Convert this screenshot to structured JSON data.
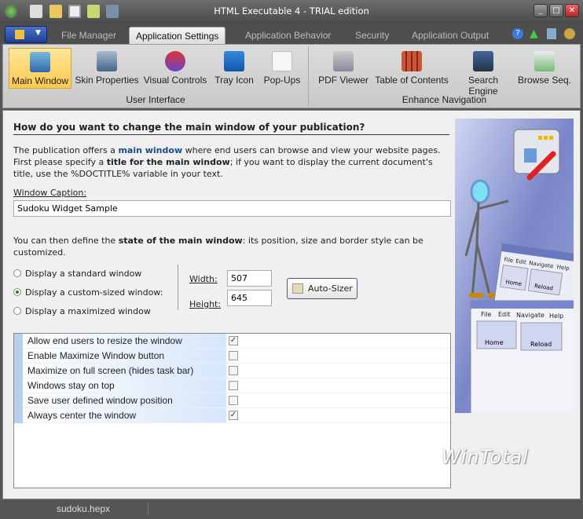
{
  "window": {
    "title": "HTML Executable 4 - TRIAL edition"
  },
  "tabs": [
    {
      "label": "File Manager"
    },
    {
      "label": "Application Settings"
    },
    {
      "label": "Application Behavior"
    },
    {
      "label": "Security"
    },
    {
      "label": "Application Output"
    }
  ],
  "ribbon": {
    "groups": [
      {
        "label": "User Interface",
        "items": [
          {
            "label": "Main Window"
          },
          {
            "label": "Skin Properties"
          },
          {
            "label": "Visual Controls"
          },
          {
            "label": "Tray Icon"
          },
          {
            "label": "Pop-Ups"
          }
        ]
      },
      {
        "label": "Enhance Navigation",
        "items": [
          {
            "label": "PDF Viewer"
          },
          {
            "label": "Table of Contents"
          },
          {
            "label": "Search Engine"
          },
          {
            "label": "Browse Seq."
          }
        ]
      }
    ]
  },
  "main": {
    "heading": "How do you want to change the main window of your publication?",
    "intro": {
      "t1": "The publication offers a ",
      "b1": "main window",
      "t2": " where end users can browse and view your website pages. First please specify a ",
      "b2": "title for the main window",
      "t3": "; if you want to display the current document's title, use the %DOCTITLE% variable in your text."
    },
    "caption_label": "Window Caption:",
    "caption_value": "Sudoku Widget Sample",
    "state": {
      "t1": "You can then define the ",
      "b1": "state of the main window",
      "t2": ": its position, size and border style can be customized."
    },
    "radios": [
      {
        "label": "Display a standard window",
        "checked": false
      },
      {
        "label": "Display a custom-sized window:",
        "checked": true
      },
      {
        "label": "Display a maximized window",
        "checked": false
      }
    ],
    "width_label": "Width:",
    "width_value": "507",
    "height_label": "Height:",
    "height_value": "645",
    "autosizer_label": "Auto-Sizer",
    "options": [
      {
        "label": "Allow end users to resize the window",
        "checked": true
      },
      {
        "label": "Enable Maximize Window button",
        "checked": false
      },
      {
        "label": "Maximize on full screen (hides task bar)",
        "checked": false
      },
      {
        "label": "Windows stay on top",
        "checked": false
      },
      {
        "label": "Save user defined window position",
        "checked": false
      },
      {
        "label": "Always center the window",
        "checked": true
      }
    ]
  },
  "illustration": {
    "menu": [
      "File",
      "Edit",
      "Navigate",
      "Help"
    ],
    "buttons": [
      "Home",
      "Reload"
    ]
  },
  "watermark": "WinTotal",
  "status": {
    "file": "sudoku.hepx"
  }
}
